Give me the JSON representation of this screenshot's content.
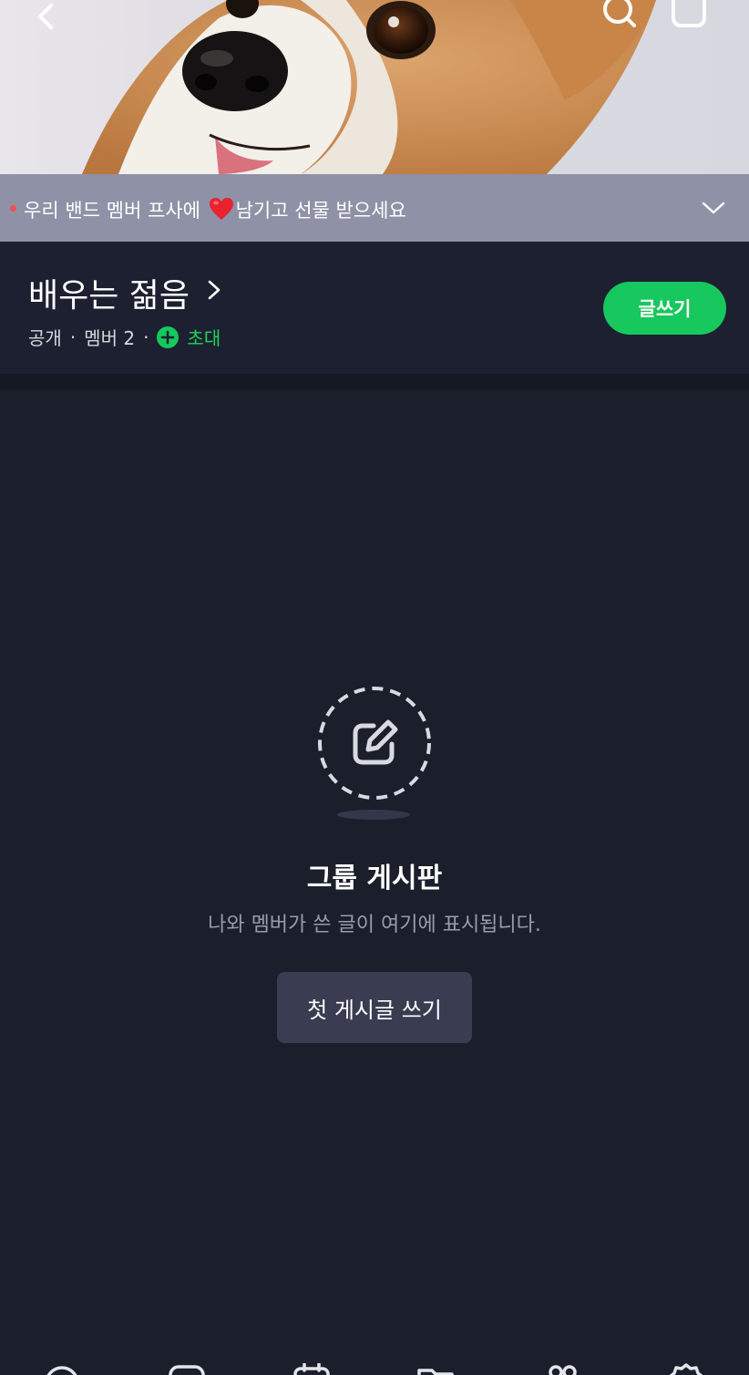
{
  "cover": {
    "icons": [
      "back-icon",
      "search-icon",
      "chat-icon"
    ]
  },
  "banner": {
    "text_before": "우리 밴드 멤버 프사에",
    "text_after": "남기고 선물 받으세요",
    "icon": "heart-icon",
    "dot_color": "#f0524e"
  },
  "group": {
    "name": "배우는 젊음",
    "visibility": "공개",
    "members_label": "멤버 2",
    "invite_label": "초대",
    "write_button": "글쓰기"
  },
  "empty_state": {
    "icon": "edit-icon",
    "title": "그룹 게시판",
    "description": "나와 멤버가 쓴 글이 여기에 표시됩니다.",
    "button": "첫 게시글 쓰기"
  },
  "bottom_nav": {
    "icons": [
      "home-icon",
      "chat-icon",
      "calendar-icon",
      "folder-icon",
      "members-icon",
      "settings-icon"
    ]
  },
  "colors": {
    "background": "#1b1e2b",
    "accent_green": "#16c85d",
    "banner": "#8f91a6"
  }
}
